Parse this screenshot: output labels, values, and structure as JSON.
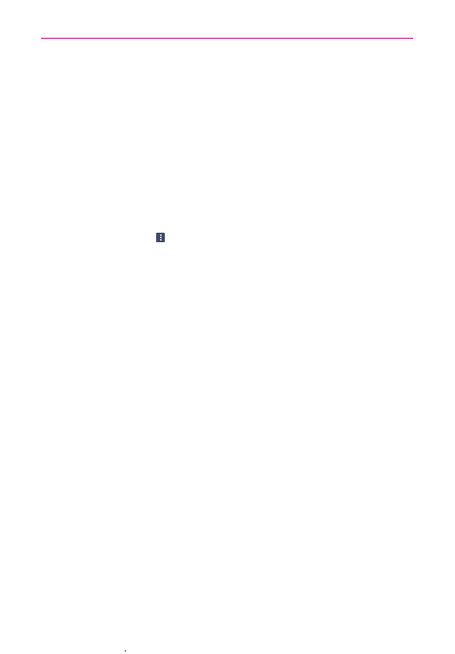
{
  "colors": {
    "header_rule": "#b5007c",
    "menu_icon_background": "#3c4a6b"
  },
  "icons": {
    "menu": "more-options-icon"
  }
}
